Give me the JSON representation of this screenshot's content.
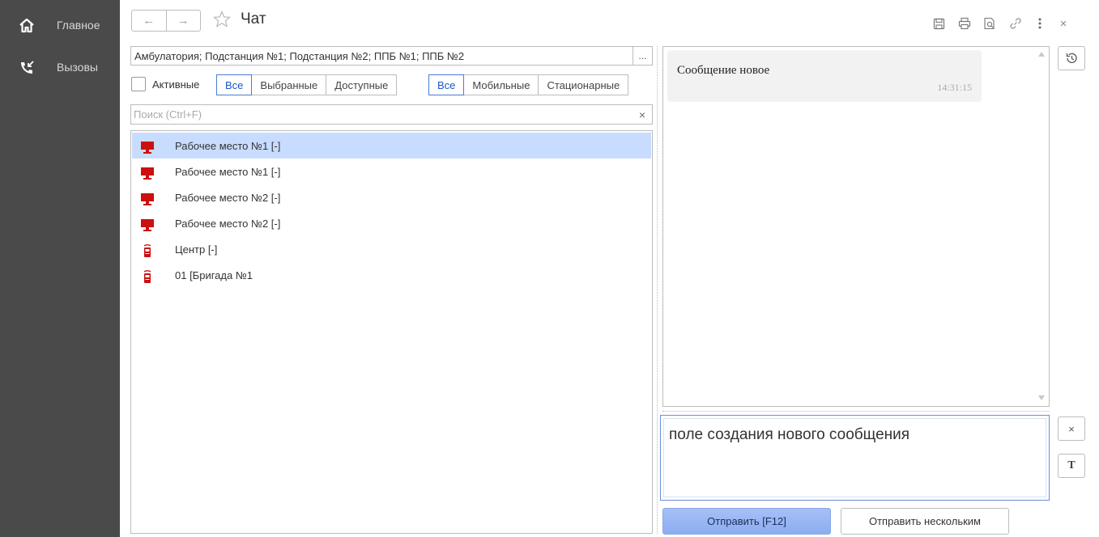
{
  "sidebar": {
    "items": [
      {
        "label": "Главное",
        "icon": "home-icon"
      },
      {
        "label": "Вызовы",
        "icon": "phone-incoming-icon"
      }
    ]
  },
  "header": {
    "back": "←",
    "forward": "→",
    "title": "Чат",
    "close": "×"
  },
  "filters": {
    "stations": "Амбулатория; Подстанция №1; Подстанция №2; ППБ №1; ППБ №2",
    "stations_more": "...",
    "active_label": "Активные",
    "scope_tabs": [
      "Все",
      "Выбранные",
      "Доступные"
    ],
    "scope_selected": "Все",
    "type_tabs": [
      "Все",
      "Мобильные",
      "Стационарные"
    ],
    "type_selected": "Все"
  },
  "search": {
    "placeholder": "Поиск (Ctrl+F)",
    "value": "",
    "clear": "×"
  },
  "contacts": [
    {
      "label": "Рабочее место №1 [-]",
      "icon": "workstation-icon",
      "selected": true
    },
    {
      "label": "Рабочее место №1 [-]",
      "icon": "workstation-icon",
      "selected": false
    },
    {
      "label": "Рабочее место №2 [-]",
      "icon": "workstation-icon",
      "selected": false
    },
    {
      "label": "Рабочее место №2 [-]",
      "icon": "workstation-icon",
      "selected": false
    },
    {
      "label": "Центр [-]",
      "icon": "mobile-device-icon",
      "selected": false
    },
    {
      "label": "01 [Бригада №1",
      "icon": "mobile-device-icon",
      "selected": false
    }
  ],
  "chat": {
    "messages": [
      {
        "text": "Сообщение новое",
        "time": "14:31:15"
      }
    ]
  },
  "composer": {
    "value": "поле создания нового сообщения",
    "clear": "×",
    "format": "T"
  },
  "actions": {
    "send": "Отправить [F12]",
    "send_many": "Отправить нескольким"
  },
  "colors": {
    "sidebar": "#4a4a4a",
    "selection": "#c8dcff",
    "accent": "#4a7cd8",
    "icon_red": "#cc1010"
  }
}
